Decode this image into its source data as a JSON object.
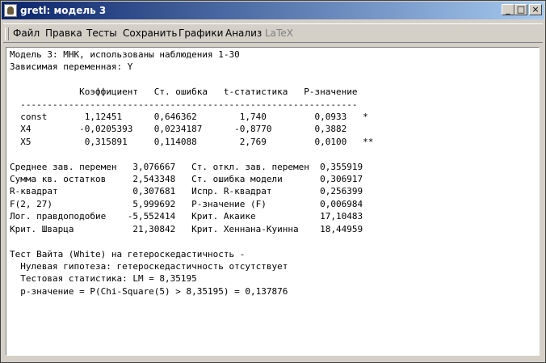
{
  "window": {
    "title": "gretl: модель 3"
  },
  "menu": {
    "items": [
      {
        "label": "Файл"
      },
      {
        "label": "Правка"
      },
      {
        "label": "Тесты"
      },
      {
        "label": "Сохранить"
      },
      {
        "label": "Графики"
      },
      {
        "label": "Анализ"
      },
      {
        "label": "LaTeX"
      }
    ]
  },
  "output": {
    "lines": [
      "Модель 3: МНК, использованы наблюдения 1-30",
      "Зависимая переменная: Y",
      "",
      "             Коэффициент   Ст. ошибка   t-статистика   P-значение",
      "  ---------------------------------------------------------------",
      "  const       1,12451      0,646362        1,740         0,0933   *",
      "  X4         -0,0205393    0,0234187      -0,8770        0,3882",
      "  X5          0,315891     0,114088        2,769         0,0100   **",
      "",
      "Среднее зав. перемен   3,076667   Ст. откл. зав. перемен  0,355919",
      "Сумма кв. остатков     2,543348   Ст. ошибка модели       0,306917",
      "R-квадрат              0,307681   Испр. R-квадрат         0,256399",
      "F(2, 27)               5,999692   P-значение (F)          0,006984",
      "Лог. правдоподобие    -5,552414   Крит. Акаике            17,10483",
      "Крит. Шварца           21,30842   Крит. Хеннана-Куинна    18,44959",
      "",
      "Тест Вайта (White) на гетероскедастичность -",
      "  Нулевая гипотеза: гетероскедастичность отсутствует",
      "  Тестовая статистика: LM = 8,35195",
      "  p-значение = P(Chi-Square(5) > 8,35195) = 0,137876"
    ]
  },
  "icons": {
    "minimize": "minimize-icon",
    "maximize": "maximize-icon",
    "close": "close-icon"
  }
}
